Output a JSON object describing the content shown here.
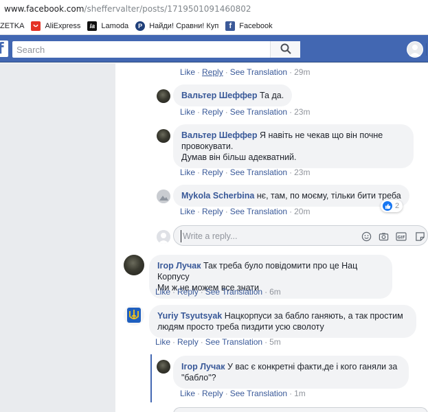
{
  "browser": {
    "url_domain": "www.facebook.com",
    "url_path": "/sheffervalter/posts/1719501091460802"
  },
  "bookmarks": [
    {
      "label": "ZETKA"
    },
    {
      "label": "AliExpress"
    },
    {
      "label": "Lamoda",
      "icon_text": "la"
    },
    {
      "label": "Найди! Сравни! Куп",
      "icon_text": "P"
    },
    {
      "label": "Facebook",
      "icon_text": "f"
    }
  ],
  "header": {
    "search_placeholder": "Search"
  },
  "actions": {
    "like": "Like",
    "reply": "Reply",
    "see_translation": "See Translation",
    "dot": "·"
  },
  "reply_box": {
    "placeholder": "Write a reply..."
  },
  "comments": [
    {
      "time": "29m"
    },
    {
      "author": "Вальтер Шеффер",
      "text": "Та да.",
      "time": "23m"
    },
    {
      "author": "Вальтер Шеффер",
      "lines": [
        "Я навіть не чекав що він почне",
        "провокувати.",
        "Думав він більш адекватний."
      ],
      "time": "23m"
    },
    {
      "author": "Mykola Scherbina",
      "text": "нє, там, по моєму, тільки бити треба",
      "time": "20m",
      "reactions": "2"
    },
    {
      "author": "Ігор Лучак",
      "lines": [
        "Так треба було повідомити про це Нац Корпусу",
        "Ми ж не можем все знати"
      ],
      "time": "6m"
    },
    {
      "author": "Yuriy Tsyutsyak",
      "lines": [
        "Нацкорпуси за бабло ганяють, а так простим",
        "людям просто треба пиздити усю сволоту"
      ],
      "time": "5m"
    },
    {
      "author": "Ігор Лучак",
      "lines": [
        "У вас є конкретні факти,де і кого ганяли за",
        "\"бабло\"?"
      ],
      "time": "1m"
    }
  ],
  "colors": {
    "fb_blue": "#4267b2",
    "link": "#385898",
    "bubble": "#f2f3f5",
    "page_gray": "#e9ebee"
  }
}
